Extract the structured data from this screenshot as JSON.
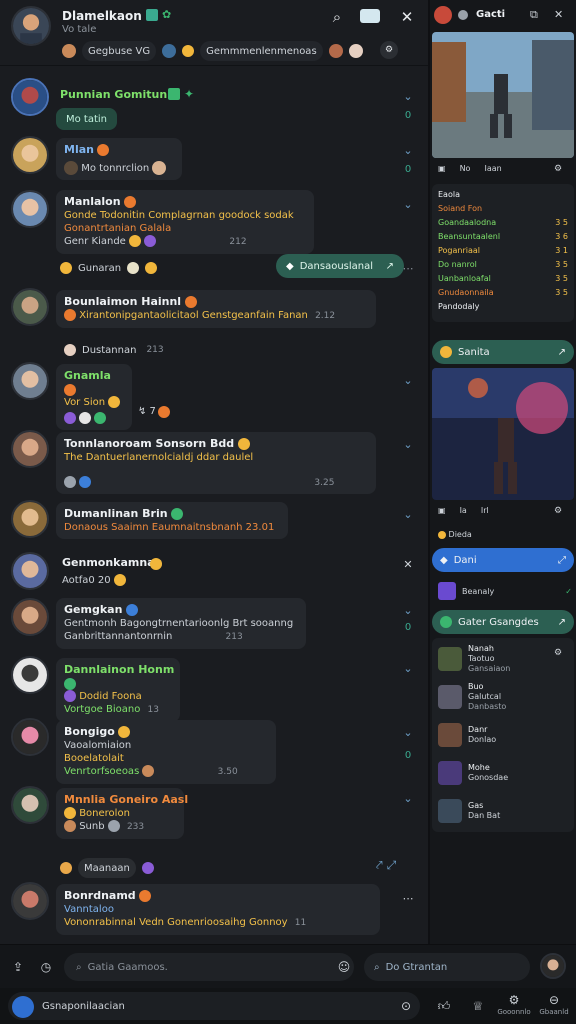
{
  "header": {
    "title": "Dlamelkaon",
    "subtitle": "Vo tale",
    "chips": [
      "Gegbuse VG",
      "Gemmmenlenmenoas"
    ],
    "icons": [
      "search-icon",
      "video-icon",
      "close-icon"
    ]
  },
  "messages": [
    {
      "name": "Punnian Gomitun",
      "lines": [
        "Mo tatin"
      ],
      "tags": ""
    },
    {
      "name": "Mlan",
      "lines": [
        "Mo tonnrclion"
      ],
      "tags": ""
    },
    {
      "name": "Manlalon",
      "lines": [
        "Gonde Todonitin Complagrnan goodock sodak",
        "Gonantrtanian Galala",
        "Genr Kiande"
      ],
      "ts": "212"
    },
    {
      "name": "Gunaran",
      "lines": [],
      "reaction": "Dansaouslanal"
    },
    {
      "name": "Bounlaimon Hainnl",
      "lines": [
        "Xirantonipgantaolicitaol Genstgeanfain Fanan"
      ],
      "ts": "2.12"
    },
    {
      "name": "Dustannan",
      "lines": [],
      "ts": "213"
    },
    {
      "name": "Gnamla",
      "lines": [
        "Vor Sion"
      ],
      "ts": ""
    },
    {
      "name": "Tonnlanoroam Sonsorn Bdd",
      "lines": [
        "The Dantuerlanernolcialdj ddar daulel"
      ],
      "ts": "3.25"
    },
    {
      "name": "Dumanlinan Brin",
      "lines": [
        "Donaous Saaimn Eaumnaitnsbnanh 23.01"
      ],
      "ts": "23.01"
    },
    {
      "name": "Genmonkamnan",
      "lines": [
        "Aotfa0 20"
      ],
      "ts": ""
    },
    {
      "name": "Gemgkan",
      "lines": [
        "Gentmonh Bagongtrnentarioonlg Brt sooanng",
        "Ganbrittannantonrnin"
      ],
      "ts": "213"
    },
    {
      "name": "Dannlainon Honm",
      "lines": [
        "Dodid Foona",
        "Vortgoe Bioano"
      ],
      "ts": "13"
    },
    {
      "name": "Bongigo",
      "lines": [
        "Vaoalomiaion",
        "Booelatolait",
        "Venrtorfsoeoas"
      ],
      "ts": "3.50"
    },
    {
      "name": "Mnnlia Goneiro Aasl",
      "lines": [
        "Bonerolon",
        "Sunb"
      ],
      "ts": "233"
    },
    {
      "name": "Maanaan",
      "lines": [],
      "ts": ""
    },
    {
      "name": "Bonrdnamd",
      "lines": [
        "Vanntaloo",
        "Vononrabinnal Vedn Gonenrioosaihg Gonnoy"
      ],
      "ts": "11"
    }
  ],
  "composer": {
    "search_placeholder": "Gatia Gaamoos.",
    "search2_placeholder": "Do Gtrantan",
    "message_value": "Gsnaponilaacian"
  },
  "bottom_tabs": [
    "Gooonnlo",
    "Gbaanld"
  ],
  "right_panel": {
    "header_title": "Gacti",
    "game_tabs": [
      "No",
      "Iaan"
    ],
    "stats_title": "Eaola",
    "stats": [
      {
        "label": "Eaola",
        "value": ""
      },
      {
        "label": "Soiand Fon",
        "value": ""
      },
      {
        "label": "Goandaalodna",
        "value": "3 5"
      },
      {
        "label": "Beansuntaalenl",
        "value": "3 6"
      },
      {
        "label": "Poganriaal",
        "value": "3 1"
      },
      {
        "label": "Do nanrol",
        "value": "3 5"
      },
      {
        "label": "Uanbanloafal",
        "value": "3 5"
      },
      {
        "label": "Gnudaonnaila",
        "value": "3 5"
      },
      {
        "label": "Pandodaly",
        "value": ""
      }
    ],
    "section1": "Sanita",
    "section2_tabs": [
      "Ia",
      "Irl"
    ],
    "section3": "Dieda",
    "section4": "Dani",
    "section5": "Beanaly",
    "section6": "Gater Gsangdes",
    "members": [
      {
        "name": "Nanah",
        "sub": "Taotuo",
        "sub2": "Gansaiaon"
      },
      {
        "name": "Buo",
        "sub": "Galutcal",
        "sub2": "Danbasto"
      },
      {
        "name": "Danr",
        "sub": "Donlao",
        "sub2": ""
      },
      {
        "name": "Mohe",
        "sub": "Gonosdae",
        "sub2": ""
      },
      {
        "name": "Gas",
        "sub": "Dan Bat",
        "sub2": ""
      }
    ]
  },
  "colors": {
    "accent_green": "#2c5f52",
    "accent_blue": "#2f6fd1",
    "name_green": "#7ee06a",
    "name_yellow": "#f3c14a"
  }
}
